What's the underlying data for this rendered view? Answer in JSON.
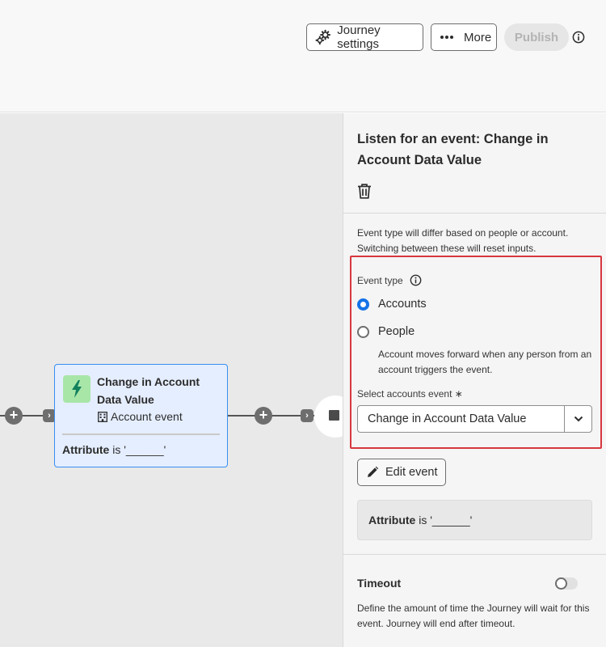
{
  "header": {
    "journey_settings_label": "Journey settings",
    "more_label": "More",
    "publish_label": "Publish"
  },
  "canvas": {
    "node": {
      "title": "Change in Account Data Value",
      "type_label": "Account event",
      "attribute_name": "Attribute",
      "attribute_rest": " is '______'",
      "icon": "lightning-bolt-icon",
      "icon_bg_color": "#a8e6a8"
    }
  },
  "panel": {
    "title": "Listen for an event: Change in Account Data Value",
    "description": "Event type will differ based on people or account. Switching between these will reset inputs.",
    "event_type_label": "Event type",
    "options": [
      {
        "label": "Accounts",
        "selected": true
      },
      {
        "label": "People",
        "selected": false
      }
    ],
    "help_text": "Account moves forward when any person from an account triggers the event.",
    "select_label": "Select accounts event ∗",
    "select_value": "Change in Account Data Value",
    "edit_label": "Edit event",
    "attribute_name": "Attribute",
    "attribute_rest": " is '______'",
    "timeout_title": "Timeout",
    "timeout_enabled": false,
    "timeout_desc": "Define the amount of time the Journey will wait for this event. Journey will end after timeout."
  },
  "colors": {
    "accent": "#1473e6",
    "highlight_border": "#d7373f",
    "node_border": "#378ef0",
    "node_bg": "#e5eeff"
  }
}
